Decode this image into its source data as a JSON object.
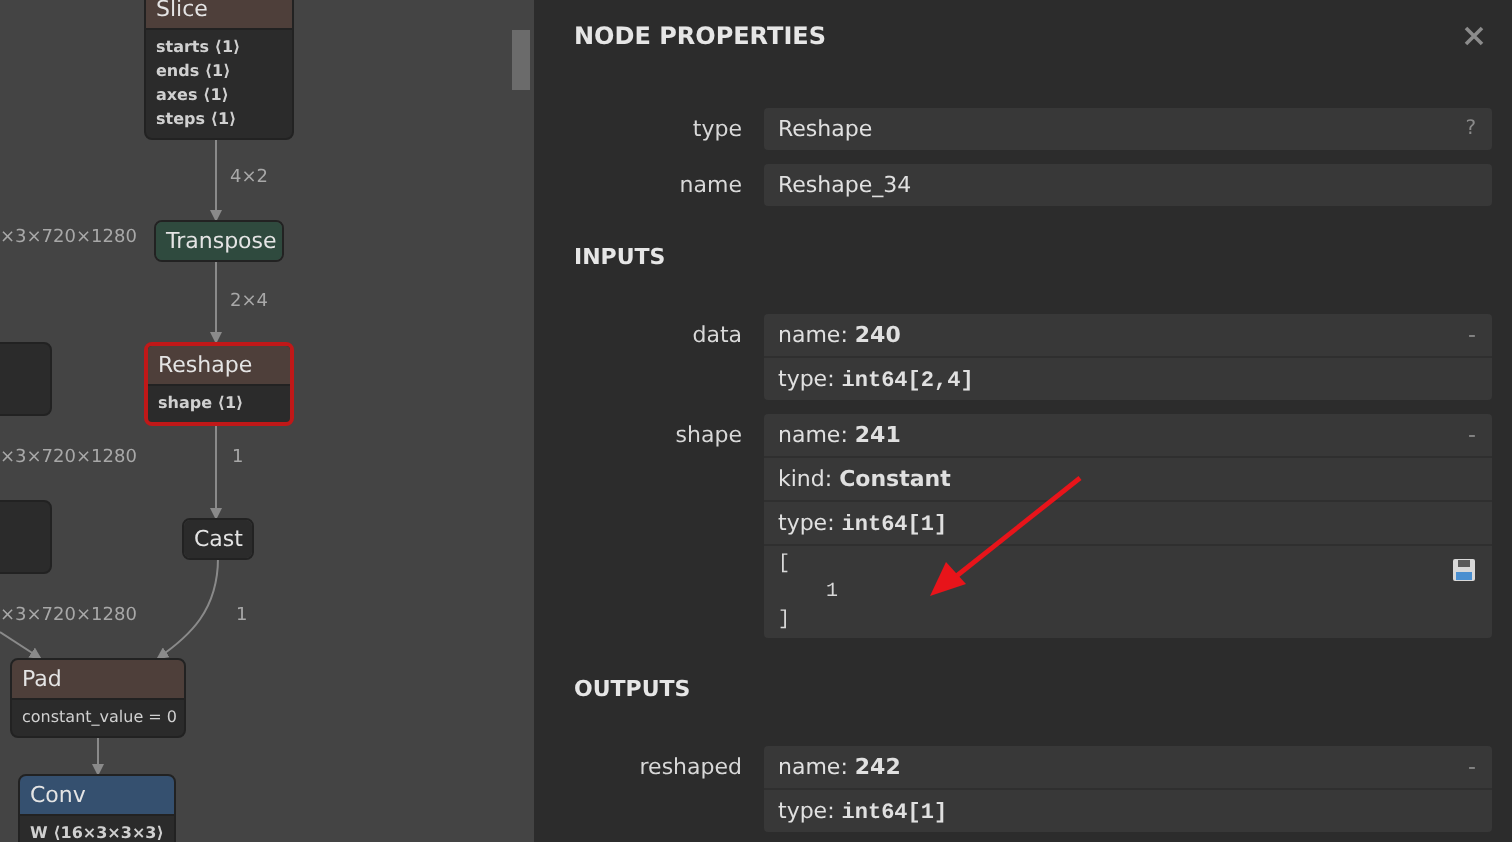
{
  "graph": {
    "nodes": [
      {
        "title": "Slice",
        "kind": "shape",
        "selected": false,
        "attributes": [
          "starts ⟨1⟩",
          "ends ⟨1⟩",
          "axes ⟨1⟩",
          "steps ⟨1⟩"
        ]
      },
      {
        "title": "Transpose",
        "kind": "transform",
        "selected": false
      },
      {
        "title": "Reshape",
        "kind": "shape",
        "selected": true,
        "attributes": [
          "shape ⟨1⟩"
        ]
      },
      {
        "title": "Cast",
        "kind": "plain",
        "selected": false
      },
      {
        "title": "Pad",
        "kind": "shape",
        "selected": false,
        "attributes": [
          "constant_value = 0"
        ]
      },
      {
        "title": "Conv",
        "kind": "layer",
        "selected": false,
        "attributes": [
          "W ⟨16×3×3×3⟩"
        ]
      }
    ],
    "edge_labels": [
      "4×2",
      "×3×720×1280",
      "2×4",
      "×3×720×1280",
      "1",
      "×3×720×1280",
      "1"
    ]
  },
  "panel": {
    "title": "NODE PROPERTIES",
    "properties": [
      {
        "label": "type",
        "value": "Reshape",
        "help": "?"
      },
      {
        "label": "name",
        "value": "Reshape_34"
      }
    ],
    "sections": [
      {
        "title": "INPUTS",
        "arguments": [
          {
            "label": "data",
            "toggle": "-",
            "fields": [
              {
                "kind": "text",
                "key": "name:",
                "value": "240"
              },
              {
                "kind": "code",
                "key": "type:",
                "value": "int64[2,4]"
              }
            ]
          },
          {
            "label": "shape",
            "toggle": "-",
            "fields": [
              {
                "kind": "text",
                "key": "name:",
                "value": "241"
              },
              {
                "kind": "text",
                "key": "kind:",
                "value": "Constant"
              },
              {
                "kind": "code",
                "key": "type:",
                "value": "int64[1]"
              },
              {
                "kind": "tensor",
                "value": "[\n    1\n]"
              }
            ]
          }
        ]
      },
      {
        "title": "OUTPUTS",
        "arguments": [
          {
            "label": "reshaped",
            "toggle": "-",
            "fields": [
              {
                "kind": "text",
                "key": "name:",
                "value": "242"
              },
              {
                "kind": "code",
                "key": "type:",
                "value": "int64[1]"
              }
            ]
          }
        ]
      }
    ]
  }
}
